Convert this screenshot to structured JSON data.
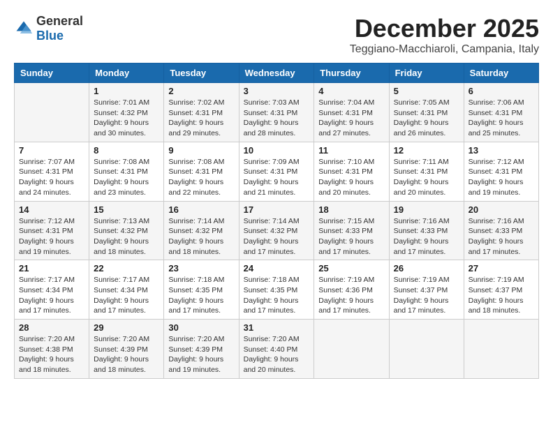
{
  "logo": {
    "general": "General",
    "blue": "Blue"
  },
  "header": {
    "month": "December 2025",
    "location": "Teggiano-Macchiaroli, Campania, Italy"
  },
  "weekdays": [
    "Sunday",
    "Monday",
    "Tuesday",
    "Wednesday",
    "Thursday",
    "Friday",
    "Saturday"
  ],
  "weeks": [
    [
      {
        "day": "",
        "info": ""
      },
      {
        "day": "1",
        "info": "Sunrise: 7:01 AM\nSunset: 4:32 PM\nDaylight: 9 hours\nand 30 minutes."
      },
      {
        "day": "2",
        "info": "Sunrise: 7:02 AM\nSunset: 4:31 PM\nDaylight: 9 hours\nand 29 minutes."
      },
      {
        "day": "3",
        "info": "Sunrise: 7:03 AM\nSunset: 4:31 PM\nDaylight: 9 hours\nand 28 minutes."
      },
      {
        "day": "4",
        "info": "Sunrise: 7:04 AM\nSunset: 4:31 PM\nDaylight: 9 hours\nand 27 minutes."
      },
      {
        "day": "5",
        "info": "Sunrise: 7:05 AM\nSunset: 4:31 PM\nDaylight: 9 hours\nand 26 minutes."
      },
      {
        "day": "6",
        "info": "Sunrise: 7:06 AM\nSunset: 4:31 PM\nDaylight: 9 hours\nand 25 minutes."
      }
    ],
    [
      {
        "day": "7",
        "info": "Sunrise: 7:07 AM\nSunset: 4:31 PM\nDaylight: 9 hours\nand 24 minutes."
      },
      {
        "day": "8",
        "info": "Sunrise: 7:08 AM\nSunset: 4:31 PM\nDaylight: 9 hours\nand 23 minutes."
      },
      {
        "day": "9",
        "info": "Sunrise: 7:08 AM\nSunset: 4:31 PM\nDaylight: 9 hours\nand 22 minutes."
      },
      {
        "day": "10",
        "info": "Sunrise: 7:09 AM\nSunset: 4:31 PM\nDaylight: 9 hours\nand 21 minutes."
      },
      {
        "day": "11",
        "info": "Sunrise: 7:10 AM\nSunset: 4:31 PM\nDaylight: 9 hours\nand 20 minutes."
      },
      {
        "day": "12",
        "info": "Sunrise: 7:11 AM\nSunset: 4:31 PM\nDaylight: 9 hours\nand 20 minutes."
      },
      {
        "day": "13",
        "info": "Sunrise: 7:12 AM\nSunset: 4:31 PM\nDaylight: 9 hours\nand 19 minutes."
      }
    ],
    [
      {
        "day": "14",
        "info": "Sunrise: 7:12 AM\nSunset: 4:31 PM\nDaylight: 9 hours\nand 19 minutes."
      },
      {
        "day": "15",
        "info": "Sunrise: 7:13 AM\nSunset: 4:32 PM\nDaylight: 9 hours\nand 18 minutes."
      },
      {
        "day": "16",
        "info": "Sunrise: 7:14 AM\nSunset: 4:32 PM\nDaylight: 9 hours\nand 18 minutes."
      },
      {
        "day": "17",
        "info": "Sunrise: 7:14 AM\nSunset: 4:32 PM\nDaylight: 9 hours\nand 17 minutes."
      },
      {
        "day": "18",
        "info": "Sunrise: 7:15 AM\nSunset: 4:33 PM\nDaylight: 9 hours\nand 17 minutes."
      },
      {
        "day": "19",
        "info": "Sunrise: 7:16 AM\nSunset: 4:33 PM\nDaylight: 9 hours\nand 17 minutes."
      },
      {
        "day": "20",
        "info": "Sunrise: 7:16 AM\nSunset: 4:33 PM\nDaylight: 9 hours\nand 17 minutes."
      }
    ],
    [
      {
        "day": "21",
        "info": "Sunrise: 7:17 AM\nSunset: 4:34 PM\nDaylight: 9 hours\nand 17 minutes."
      },
      {
        "day": "22",
        "info": "Sunrise: 7:17 AM\nSunset: 4:34 PM\nDaylight: 9 hours\nand 17 minutes."
      },
      {
        "day": "23",
        "info": "Sunrise: 7:18 AM\nSunset: 4:35 PM\nDaylight: 9 hours\nand 17 minutes."
      },
      {
        "day": "24",
        "info": "Sunrise: 7:18 AM\nSunset: 4:35 PM\nDaylight: 9 hours\nand 17 minutes."
      },
      {
        "day": "25",
        "info": "Sunrise: 7:19 AM\nSunset: 4:36 PM\nDaylight: 9 hours\nand 17 minutes."
      },
      {
        "day": "26",
        "info": "Sunrise: 7:19 AM\nSunset: 4:37 PM\nDaylight: 9 hours\nand 17 minutes."
      },
      {
        "day": "27",
        "info": "Sunrise: 7:19 AM\nSunset: 4:37 PM\nDaylight: 9 hours\nand 18 minutes."
      }
    ],
    [
      {
        "day": "28",
        "info": "Sunrise: 7:20 AM\nSunset: 4:38 PM\nDaylight: 9 hours\nand 18 minutes."
      },
      {
        "day": "29",
        "info": "Sunrise: 7:20 AM\nSunset: 4:39 PM\nDaylight: 9 hours\nand 18 minutes."
      },
      {
        "day": "30",
        "info": "Sunrise: 7:20 AM\nSunset: 4:39 PM\nDaylight: 9 hours\nand 19 minutes."
      },
      {
        "day": "31",
        "info": "Sunrise: 7:20 AM\nSunset: 4:40 PM\nDaylight: 9 hours\nand 20 minutes."
      },
      {
        "day": "",
        "info": ""
      },
      {
        "day": "",
        "info": ""
      },
      {
        "day": "",
        "info": ""
      }
    ]
  ]
}
